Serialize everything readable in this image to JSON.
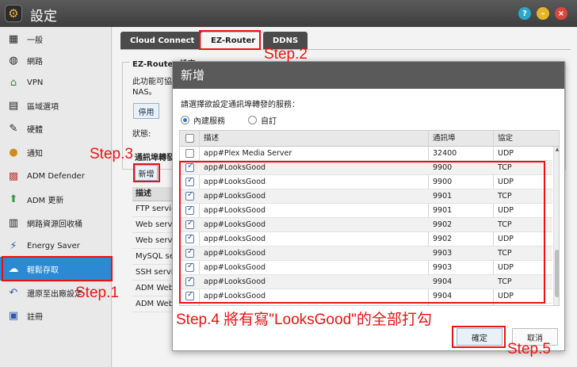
{
  "window": {
    "title": "設定"
  },
  "sidebar": {
    "items": [
      {
        "label": "一般",
        "icon": "settings-icon"
      },
      {
        "label": "網路",
        "icon": "globe-icon"
      },
      {
        "label": "VPN",
        "icon": "vpn-icon"
      },
      {
        "label": "區域選項",
        "icon": "region-icon"
      },
      {
        "label": "硬體",
        "icon": "wrench-icon"
      },
      {
        "label": "通知",
        "icon": "alert-icon"
      },
      {
        "label": "ADM Defender",
        "icon": "firewall-icon"
      },
      {
        "label": "ADM 更新",
        "icon": "update-arrow-icon"
      },
      {
        "label": "網路資源回收桶",
        "icon": "trash-icon"
      },
      {
        "label": "Energy Saver",
        "icon": "lightning-icon"
      },
      {
        "label": "輕鬆存取",
        "icon": "cloud-icon"
      },
      {
        "label": "還原至出廠設定",
        "icon": "undo-icon"
      },
      {
        "label": "註冊",
        "icon": "register-icon"
      }
    ]
  },
  "tabs": [
    "Cloud Connect",
    "EZ-Router",
    "DDNS"
  ],
  "background": {
    "section_title": "EZ-Router 設定",
    "description": "此功能可協 NAS。",
    "stop_label": "停用",
    "status_label": "狀態:",
    "port_forward_title": "通訊埠轉發",
    "add_label": "新增",
    "table_header": "描述",
    "rows": [
      "FTP service",
      "Web service",
      "Web service",
      "MySQL service",
      "SSH service",
      "ADM Web",
      "ADM Web"
    ]
  },
  "dialog": {
    "title": "新增",
    "prompt": "請選擇欲設定通訊埠轉發的服務：",
    "radio_builtin": "內建服務",
    "radio_custom": "自訂",
    "columns": {
      "description": "描述",
      "port": "通訊埠",
      "protocol": "協定"
    },
    "rows": [
      {
        "description": "app#Plex Media Server",
        "port": "32400",
        "protocol": "UDP"
      },
      {
        "description": "app#LooksGood",
        "port": "9900",
        "protocol": "TCP"
      },
      {
        "description": "app#LooksGood",
        "port": "9900",
        "protocol": "UDP"
      },
      {
        "description": "app#LooksGood",
        "port": "9901",
        "protocol": "TCP"
      },
      {
        "description": "app#LooksGood",
        "port": "9901",
        "protocol": "UDP"
      },
      {
        "description": "app#LooksGood",
        "port": "9902",
        "protocol": "TCP"
      },
      {
        "description": "app#LooksGood",
        "port": "9902",
        "protocol": "UDP"
      },
      {
        "description": "app#LooksGood",
        "port": "9903",
        "protocol": "TCP"
      },
      {
        "description": "app#LooksGood",
        "port": "9903",
        "protocol": "UDP"
      },
      {
        "description": "app#LooksGood",
        "port": "9904",
        "protocol": "TCP"
      },
      {
        "description": "app#LooksGood",
        "port": "9904",
        "protocol": "UDP"
      }
    ],
    "ok_label": "確定",
    "cancel_label": "取消"
  },
  "annotations": {
    "step1": "Step.1",
    "step2": "Step.2",
    "step3": "Step.3",
    "step4": "Step.4 將有寫\"LooksGood\"的全部打勾",
    "step5": "Step.5"
  },
  "colors": {
    "annotation": "#e11111",
    "active_nav": "#2a8ad4",
    "title_bar": "#4a4a4a"
  }
}
